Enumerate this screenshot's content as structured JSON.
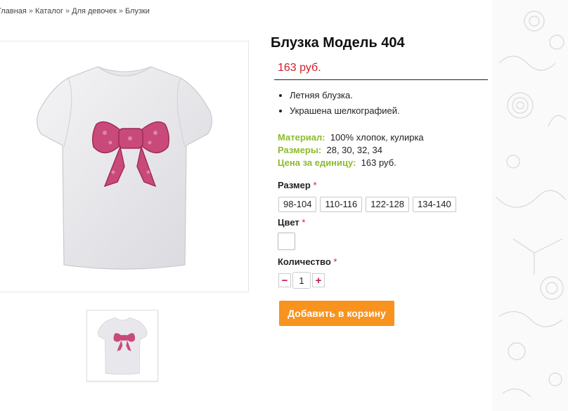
{
  "breadcrumb": {
    "items": [
      "Главная",
      "Каталог",
      "Для девочек",
      "Блузки"
    ],
    "separator": "»"
  },
  "product": {
    "title": "Блузка Модель 404",
    "price": "163 руб.",
    "features": [
      "Летняя блузка.",
      "Украшена шелкографией."
    ],
    "specs": [
      {
        "label": "Материал:",
        "value": "100% хлопок, кулирка"
      },
      {
        "label": "Размеры:",
        "value": "28, 30, 32, 34"
      },
      {
        "label": "Цена за единицу:",
        "value": "163 руб."
      }
    ],
    "image_icon": "tshirt-with-bow-image"
  },
  "options": {
    "size_label": "Размер",
    "sizes": [
      "98-104",
      "110-116",
      "122-128",
      "134-140"
    ],
    "color_label": "Цвет",
    "quantity_label": "Количество",
    "required_mark": "*",
    "quantity_value": "1",
    "minus": "−",
    "plus": "+"
  },
  "cart": {
    "add_label": "Добавить в корзину"
  },
  "colors": {
    "accent_orange": "#f7931e",
    "price_red": "#d01e2a",
    "spec_green": "#8dbb2d",
    "qty_pink": "#c2185b"
  }
}
